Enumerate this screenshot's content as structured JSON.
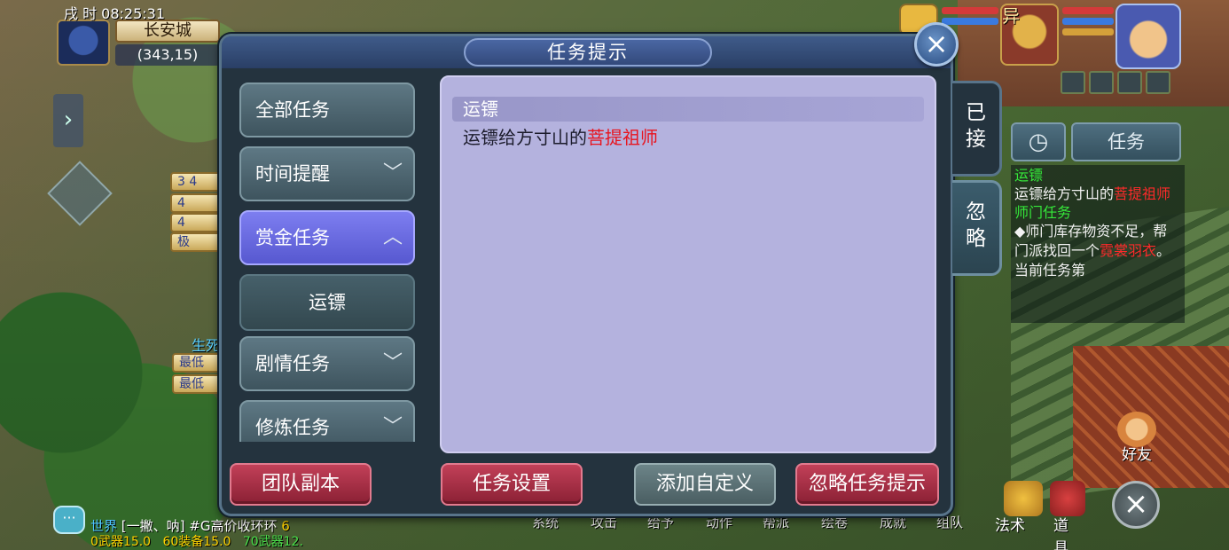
{
  "hud": {
    "time": "戌 时  08:25:31",
    "city": "长安城",
    "coords": "(343,15)",
    "name_abbr": "异",
    "left_tags": [
      "3 4",
      "4",
      "4",
      "极"
    ],
    "left_labels": [
      "生死",
      "最低",
      "最低"
    ]
  },
  "dialog": {
    "title": "任务提示",
    "close_icon": "×",
    "categories": [
      {
        "label": "全部任务",
        "chevron": ""
      },
      {
        "label": "时间提醒",
        "chevron": "﹀"
      },
      {
        "label": "赏金任务",
        "chevron": "︿"
      },
      {
        "label": "运镖",
        "chevron": ""
      },
      {
        "label": "剧情任务",
        "chevron": "﹀"
      },
      {
        "label": "修炼任务",
        "chevron": "﹀"
      }
    ],
    "task": {
      "name": "运镖",
      "desc_prefix": "运镖给方寸山的",
      "desc_highlight": "菩提祖师"
    },
    "side_tabs": {
      "accepted": "已\n接",
      "ignored": "忽\n略"
    },
    "buttons": {
      "team_dungeon": "团队副本",
      "task_settings": "任务设置",
      "add_custom": "添加自定义",
      "ignore_hints": "忽略任务提示"
    }
  },
  "tracker": {
    "timer_icon": "◷",
    "task_tab": "任务",
    "items": [
      {
        "title": "运镖",
        "body_prefix": "运镖给方寸山的",
        "body_red": "菩提祖师",
        "body_suffix": ""
      },
      {
        "title": "师门任务",
        "body_prefix": "◆师门库存物资不足，帮门派找回一个",
        "body_red": "霓裳羽衣",
        "body_suffix": "。当前任务第"
      }
    ]
  },
  "social": {
    "friend_label": "好友",
    "close_icon": "×"
  },
  "chat": {
    "bubble_icon": "···",
    "channel": "世界",
    "message": "[一撇、呐] #G高价收环环",
    "count": "6",
    "trade_a": "0武器15.0",
    "trade_b": "60装备15.0",
    "trade_c": "70武器12."
  },
  "bottom_menu": [
    "系统",
    "攻击",
    "给予",
    "动作",
    "帮派",
    "绘卷",
    "成就",
    "组队",
    "法术",
    "道具"
  ]
}
